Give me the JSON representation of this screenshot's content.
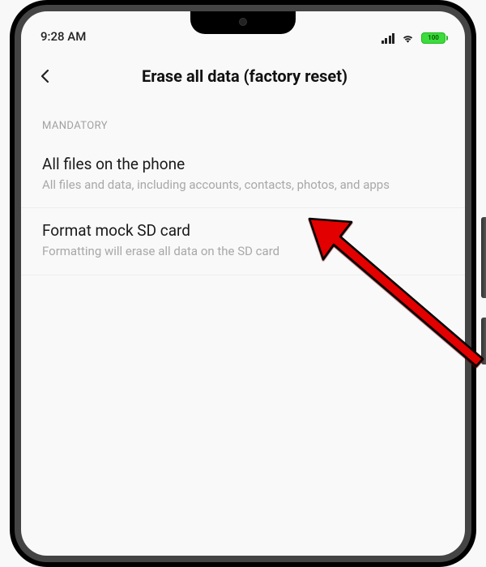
{
  "status": {
    "time": "9:28 AM",
    "battery_pct": "100"
  },
  "header": {
    "title": "Erase all data (factory reset)"
  },
  "section": {
    "label": "MANDATORY"
  },
  "items": [
    {
      "title": "All files on the phone",
      "desc": "All files and data, including accounts, contacts, photos, and apps"
    },
    {
      "title": "Format mock SD card",
      "desc": "Formatting will erase all data on the SD card"
    }
  ]
}
